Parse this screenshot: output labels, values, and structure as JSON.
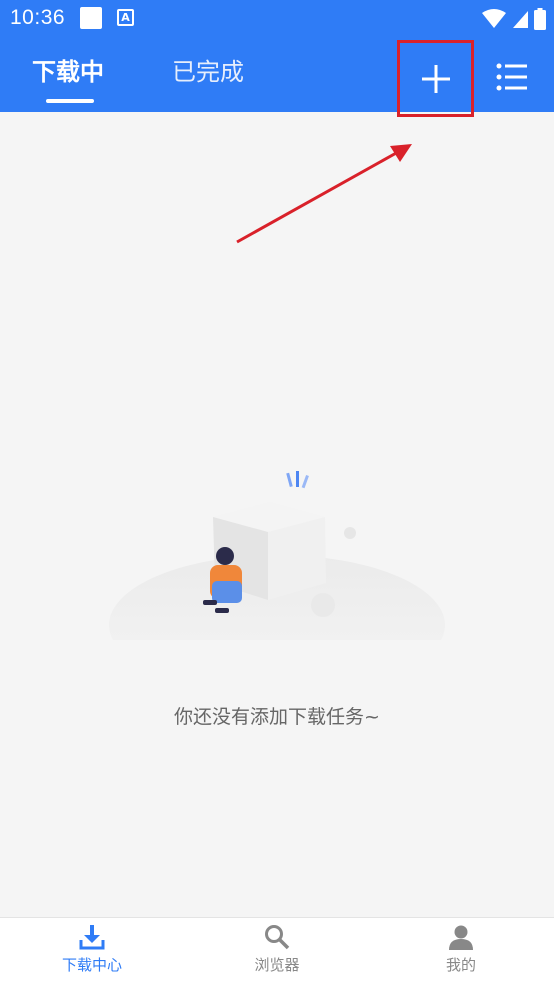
{
  "status_bar": {
    "time": "10:36",
    "app_badge": "A"
  },
  "header": {
    "tabs": [
      {
        "label": "下载中",
        "active": true
      },
      {
        "label": "已完成",
        "active": false
      }
    ]
  },
  "empty_state": {
    "message": "你还没有添加下载任务~"
  },
  "bottom_nav": {
    "items": [
      {
        "label": "下载中心",
        "icon": "download-icon",
        "active": true
      },
      {
        "label": "浏览器",
        "icon": "search-icon",
        "active": false
      },
      {
        "label": "我的",
        "icon": "person-icon",
        "active": false
      }
    ]
  },
  "colors": {
    "primary": "#2f7cf6",
    "annotation_red": "#d9212a",
    "background": "#f5f5f5"
  }
}
